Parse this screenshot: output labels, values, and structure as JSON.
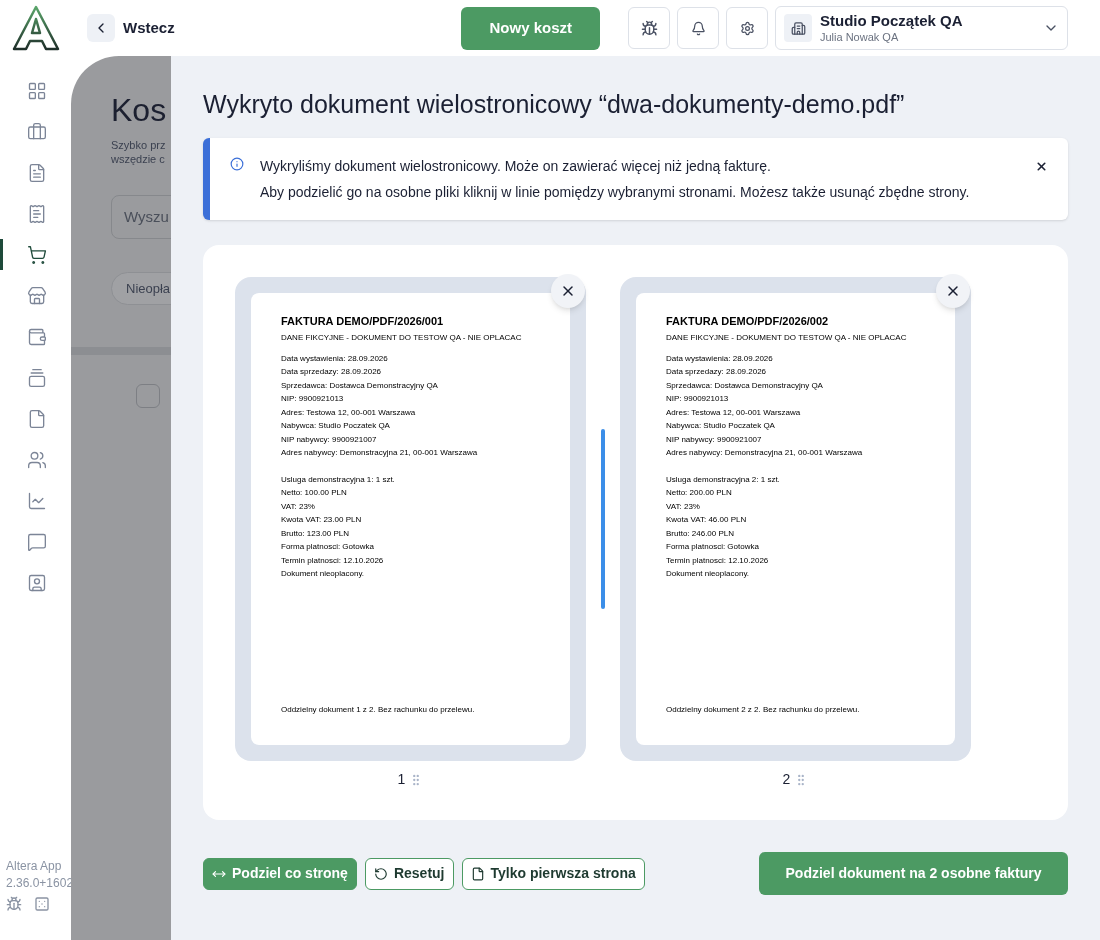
{
  "topbar": {
    "back": "Wstecz",
    "new_button": "Nowy koszt",
    "company": "Studio Początek QA",
    "user": "Julia Nowak QA"
  },
  "sidebar": {
    "items": [
      {
        "kind": "grid",
        "selected": false
      },
      {
        "kind": "briefcase",
        "selected": false
      },
      {
        "kind": "file-check",
        "selected": false
      },
      {
        "kind": "receipt",
        "selected": false
      },
      {
        "kind": "cart",
        "selected": true
      },
      {
        "kind": "store",
        "selected": false
      },
      {
        "kind": "wallet",
        "selected": false
      },
      {
        "kind": "cards",
        "selected": false
      },
      {
        "kind": "file",
        "selected": false
      },
      {
        "kind": "users",
        "selected": false
      },
      {
        "kind": "chart",
        "selected": false
      },
      {
        "kind": "chat",
        "selected": false
      },
      {
        "kind": "contact",
        "selected": false
      }
    ],
    "app_name": "Altera App",
    "version": "2.36.0+1602"
  },
  "background_page": {
    "title": "Kos",
    "subtitle_lines": [
      "Szybko prz",
      "wszędzie c"
    ],
    "search_placeholder": "Wyszu",
    "filter": "Nieopła",
    "row_checkbox": {
      "checked": false
    }
  },
  "dialog": {
    "title": "Wykryto dokument wielostronicowy “dwa-dokumenty-demo.pdf”",
    "alert_lines": [
      "Wykryliśmy dokument wielostronicowy. Może on zawierać więcej niż jedną fakturę.",
      "Aby podzielić go na osobne pliki kliknij w linie pomiędzy wybranymi stronami. Możesz także usunąć zbędne strony."
    ],
    "pages": [
      {
        "number": "1",
        "heading": "FAKTURA DEMO/PDF/2026/001",
        "sections": [
          [
            "DANE FIKCYJNE - DOKUMENT DO TESTOW QA - NIE OPLACAC"
          ],
          [
            "Data wystawienia: 28.09.2026",
            "Data sprzedazy: 28.09.2026",
            "Sprzedawca: Dostawca Demonstracyjny QA",
            "NIP: 9900921013",
            "Adres: Testowa 12, 00-001 Warszawa",
            "Nabywca: Studio Poczatek QA",
            "NIP nabywcy: 9900921007",
            "Adres nabywcy: Demonstracyjna 21, 00-001 Warszawa"
          ],
          [
            "Usluga demonstracyjna 1: 1 szt.",
            "Netto: 100.00 PLN",
            "VAT: 23%",
            "Kwota VAT: 23.00 PLN",
            "Brutto: 123.00 PLN",
            "Forma platnosci: Gotowka",
            "Termin platnosci: 12.10.2026",
            "Dokument nieoplacony."
          ]
        ],
        "footer": "Oddzielny dokument 1 z 2. Bez rachunku do przelewu."
      },
      {
        "number": "2",
        "heading": "FAKTURA DEMO/PDF/2026/002",
        "sections": [
          [
            "DANE FIKCYJNE - DOKUMENT DO TESTOW QA - NIE OPLACAC"
          ],
          [
            "Data wystawienia: 28.09.2026",
            "Data sprzedazy: 28.09.2026",
            "Sprzedawca: Dostawca Demonstracyjny QA",
            "NIP: 9900921013",
            "Adres: Testowa 12, 00-001 Warszawa",
            "Nabywca: Studio Poczatek QA",
            "NIP nabywcy: 9900921007",
            "Adres nabywcy: Demonstracyjna 21, 00-001 Warszawa"
          ],
          [
            "Usluga demonstracyjna 2: 1 szt.",
            "Netto: 200.00 PLN",
            "VAT: 23%",
            "Kwota VAT: 46.00 PLN",
            "Brutto: 246.00 PLN",
            "Forma platnosci: Gotowka",
            "Termin platnosci: 12.10.2026",
            "Dokument nieoplacony."
          ]
        ],
        "footer": "Oddzielny dokument 2 z 2. Bez rachunku do przelewu."
      }
    ],
    "dividers": [
      {
        "split": true
      }
    ],
    "actions": [
      {
        "label": "Podziel co stronę",
        "kind": "primary"
      },
      {
        "label": "Resetuj",
        "kind": "outline"
      },
      {
        "label": "Tylko pierwsza strona",
        "kind": "outline"
      }
    ],
    "submit": "Podziel dokument na 2 osobne faktury"
  }
}
